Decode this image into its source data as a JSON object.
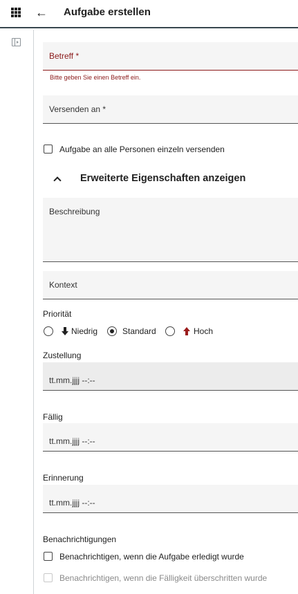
{
  "header": {
    "title": "Aufgabe erstellen",
    "apps_icon": "apps-grid-icon",
    "back_icon": "arrow-back-icon"
  },
  "siderail": {
    "toggle_icon": "panel-toggle-icon"
  },
  "form": {
    "subject": {
      "label": "Betreff *",
      "value": "",
      "error": "Bitte geben Sie einen Betreff ein."
    },
    "send_to": {
      "label": "Versenden an *",
      "value": ""
    },
    "send_individually": {
      "label": "Aufgabe an alle Personen einzeln versenden",
      "checked": false
    },
    "advanced_toggle": {
      "label": "Erweiterte Eigenschaften anzeigen",
      "expanded": true
    },
    "description": {
      "label": "Beschreibung",
      "value": ""
    },
    "context": {
      "label": "Kontext",
      "value": ""
    },
    "priority": {
      "label": "Priorität",
      "options": [
        {
          "label": "Niedrig",
          "icon": "arrow-down-icon",
          "checked": false
        },
        {
          "label": "Standard",
          "icon": "",
          "checked": true
        },
        {
          "label": "Hoch",
          "icon": "arrow-up-icon",
          "checked": false,
          "icon_color": "#9b1c1c"
        }
      ]
    },
    "delivery": {
      "label": "Zustellung",
      "value": "tt.mm.jjjj --:--"
    },
    "due": {
      "label": "Fällig",
      "value": "tt.mm.jjjj --:--"
    },
    "reminder": {
      "label": "Erinnerung",
      "value": "tt.mm.jjjj --:--"
    },
    "notifications": {
      "label": "Benachrichtigungen",
      "on_complete": {
        "label": "Benachrichtigen, wenn die Aufgabe erledigt wurde",
        "checked": false
      },
      "on_overdue": {
        "label": "Benachrichtigen, wenn die Fälligkeit überschritten wurde",
        "checked": false,
        "disabled": true
      }
    }
  },
  "colors": {
    "error": "#8b1a1a",
    "header_border": "#37474f",
    "field_bg": "#f5f5f5"
  }
}
